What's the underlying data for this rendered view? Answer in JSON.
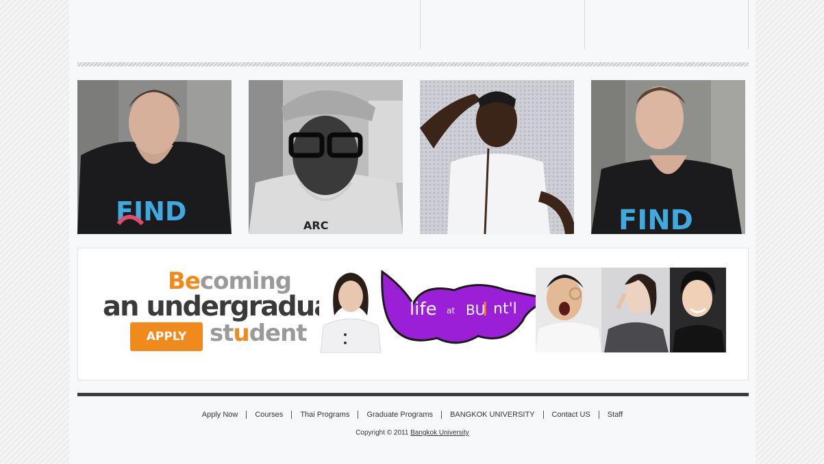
{
  "banner": {
    "headline_line1_accent": "Be",
    "headline_line1_rest": "coming",
    "headline_line2": "an undergraduate",
    "headline_line3_a": "st",
    "headline_line3_accent": "u",
    "headline_line3_b": "dent",
    "apply_button": "APPLY NOW",
    "bubble_life": "life",
    "bubble_at": "at",
    "bubble_bu": "BU",
    "bubble_i": "I",
    "bubble_ntl": "nt'l"
  },
  "footer": {
    "nav": [
      "Apply Now",
      "Courses",
      "Thai Programs",
      "Graduate Programs",
      "BANGKOK UNIVERSITY",
      "Contact US",
      "Staff"
    ],
    "copyright_prefix": "Copyright © 2011",
    "copyright_link": "Bangkok University"
  },
  "colors": {
    "accent_orange": "#f08a1c",
    "bubble_purple": "#9b1fd6",
    "footer_rule": "#3c3c40"
  }
}
